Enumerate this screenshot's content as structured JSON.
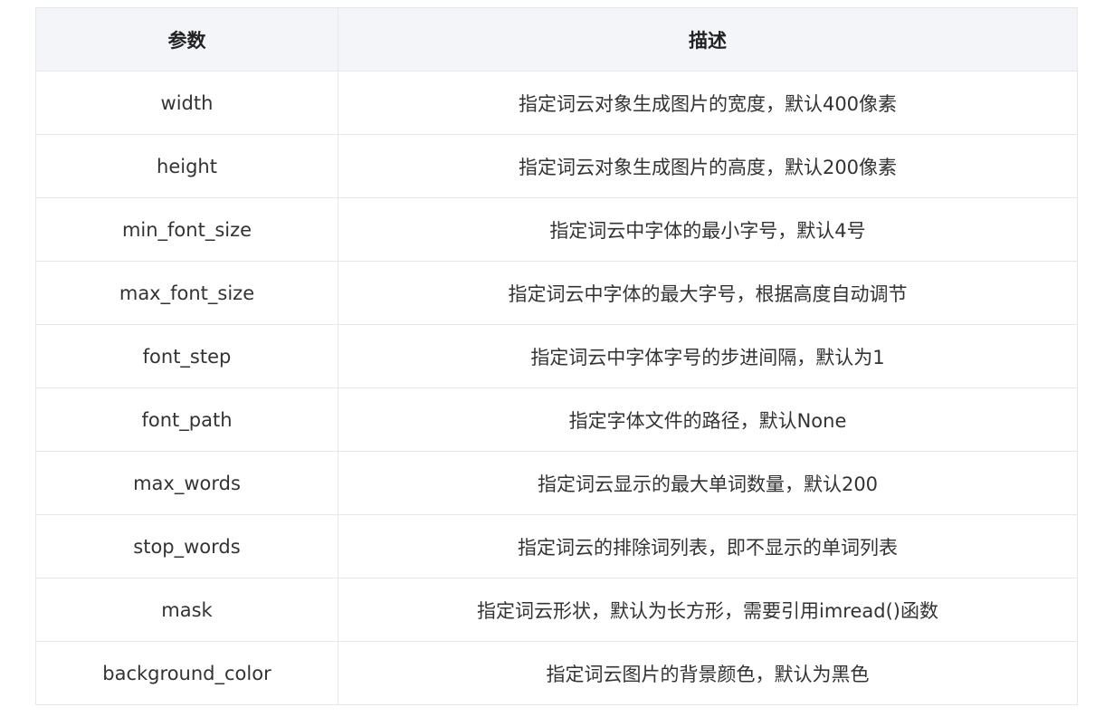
{
  "table": {
    "headers": [
      "参数",
      "描述"
    ],
    "rows": [
      [
        "width",
        "指定词云对象生成图片的宽度，默认400像素"
      ],
      [
        "height",
        "指定词云对象生成图片的高度，默认200像素"
      ],
      [
        "min_font_size",
        "指定词云中字体的最小字号，默认4号"
      ],
      [
        "max_font_size",
        "指定词云中字体的最大字号，根据高度自动调节"
      ],
      [
        "font_step",
        "指定词云中字体字号的步进间隔，默认为1"
      ],
      [
        "font_path",
        "指定字体文件的路径，默认None"
      ],
      [
        "max_words",
        "指定词云显示的最大单词数量，默认200"
      ],
      [
        "stop_words",
        "指定词云的排除词列表，即不显示的单词列表"
      ],
      [
        "mask",
        "指定词云形状，默认为长方形，需要引用imread()函数"
      ],
      [
        "background_color",
        "指定词云图片的背景颜色，默认为黑色"
      ]
    ]
  }
}
